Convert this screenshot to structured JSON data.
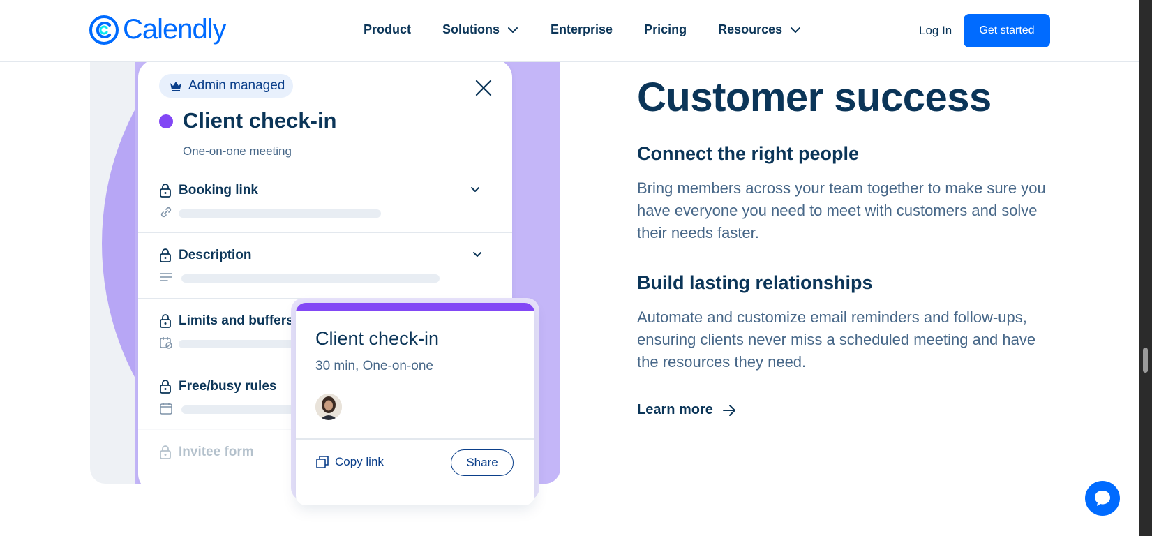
{
  "header": {
    "logo_text": "Calendly",
    "nav": [
      {
        "label": "Product",
        "has_dropdown": false
      },
      {
        "label": "Solutions",
        "has_dropdown": true
      },
      {
        "label": "Enterprise",
        "has_dropdown": false
      },
      {
        "label": "Pricing",
        "has_dropdown": false
      },
      {
        "label": "Resources",
        "has_dropdown": true
      }
    ],
    "login_label": "Log In",
    "cta_label": "Get started"
  },
  "illustration": {
    "badge_label": "Admin managed",
    "event_title": "Client check-in",
    "event_subtitle": "One-on-one meeting",
    "rows": [
      {
        "label": "Booking link",
        "sub_icon": "link-icon",
        "has_chevron": true
      },
      {
        "label": "Description",
        "sub_icon": "text-lines-icon",
        "has_chevron": true
      },
      {
        "label": "Limits and buffers",
        "sub_icon": "calendar-clock-icon",
        "has_chevron": false
      },
      {
        "label": "Free/busy rules",
        "sub_icon": "calendar-icon",
        "has_chevron": false
      },
      {
        "label": "Invitee form",
        "sub_icon": "form-icon",
        "has_chevron": false
      }
    ],
    "popup": {
      "title": "Client check-in",
      "subtitle": "30 min, One-on-one",
      "copy_link_label": "Copy link",
      "share_label": "Share"
    }
  },
  "content": {
    "title": "Customer success",
    "sections": [
      {
        "heading": "Connect the right people",
        "body": "Bring members across your team together to make sure you have everyone you need to meet with customers and solve their needs faster."
      },
      {
        "heading": "Build lasting relationships",
        "body": "Automate and customize email reminders and follow-ups, ensuring clients never miss a scheduled meeting and have the resources they need."
      }
    ],
    "learn_more_label": "Learn more"
  },
  "colors": {
    "brand_blue": "#006bff",
    "navy": "#0b3558",
    "slate": "#476788",
    "purple": "#8247f5",
    "lavender": "#b7a6f5"
  }
}
